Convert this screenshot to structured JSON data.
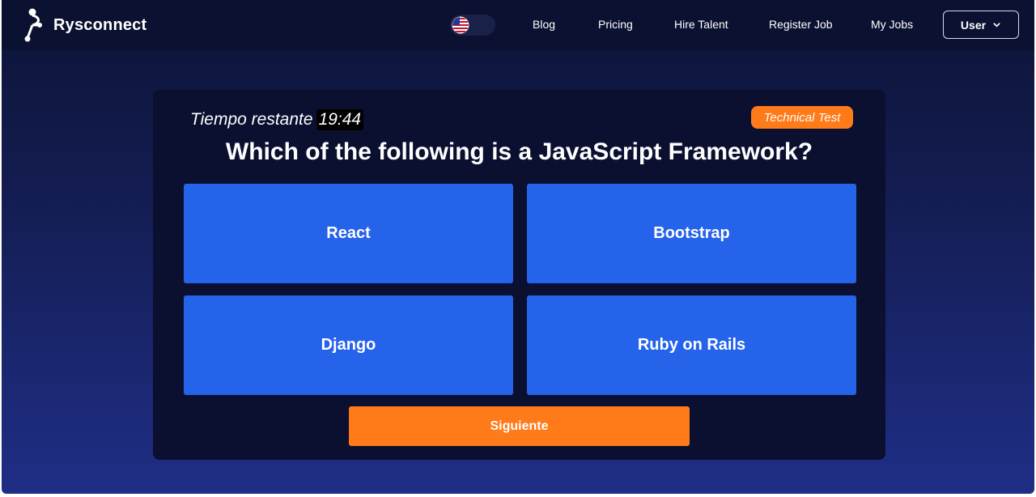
{
  "brand": {
    "name": "Rysconnect"
  },
  "nav": {
    "links": [
      "Blog",
      "Pricing",
      "Hire Talent",
      "Register Job",
      "My Jobs"
    ],
    "user_label": "User",
    "language_toggle_icon": "us-flag-icon"
  },
  "quiz": {
    "timer_label": "Tiempo restante",
    "timer_value": "19:44",
    "badge": "Technical Test",
    "question": "Which of the following is a JavaScript  Framework?",
    "options": [
      "React",
      "Bootstrap",
      "Django",
      "Ruby on Rails"
    ],
    "next_label": "Siguiente"
  },
  "colors": {
    "accent_orange": "#ff7a18",
    "option_blue": "#2563eb",
    "card_bg": "#0b1030",
    "nav_bg": "#0b1130"
  }
}
